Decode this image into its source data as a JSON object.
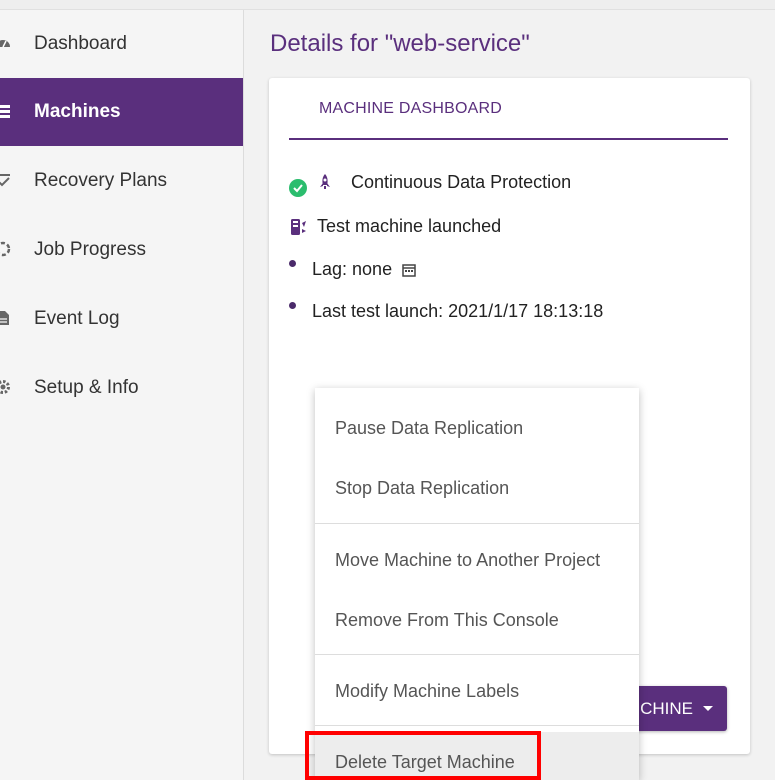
{
  "sidebar": {
    "items": [
      {
        "label": "Dashboard",
        "icon": "gauge-icon"
      },
      {
        "label": "Machines",
        "icon": "server-icon",
        "active": true
      },
      {
        "label": "Recovery Plans",
        "icon": "checklist-icon"
      },
      {
        "label": "Job Progress",
        "icon": "spinner-icon"
      },
      {
        "label": "Event Log",
        "icon": "document-icon"
      },
      {
        "label": "Setup & Info",
        "icon": "gear-icon"
      }
    ]
  },
  "main": {
    "title": "Details for \"web-service\"",
    "tab": "MACHINE DASHBOARD",
    "status": {
      "cdp": "Continuous Data Protection",
      "test_launched": "Test machine launched",
      "lag": "Lag: none",
      "last_test": "Last test launch: 2021/1/17 18:13:18"
    },
    "machine_button": "CHINE"
  },
  "menu": {
    "items": [
      "Pause Data Replication",
      "Stop Data Replication",
      "Move Machine to Another Project",
      "Remove From This Console",
      "Modify Machine Labels",
      "Delete Target Machine"
    ]
  },
  "colors": {
    "accent": "#5a2f7d",
    "success": "#2bbd6e",
    "highlight_box": "#ff0000"
  }
}
